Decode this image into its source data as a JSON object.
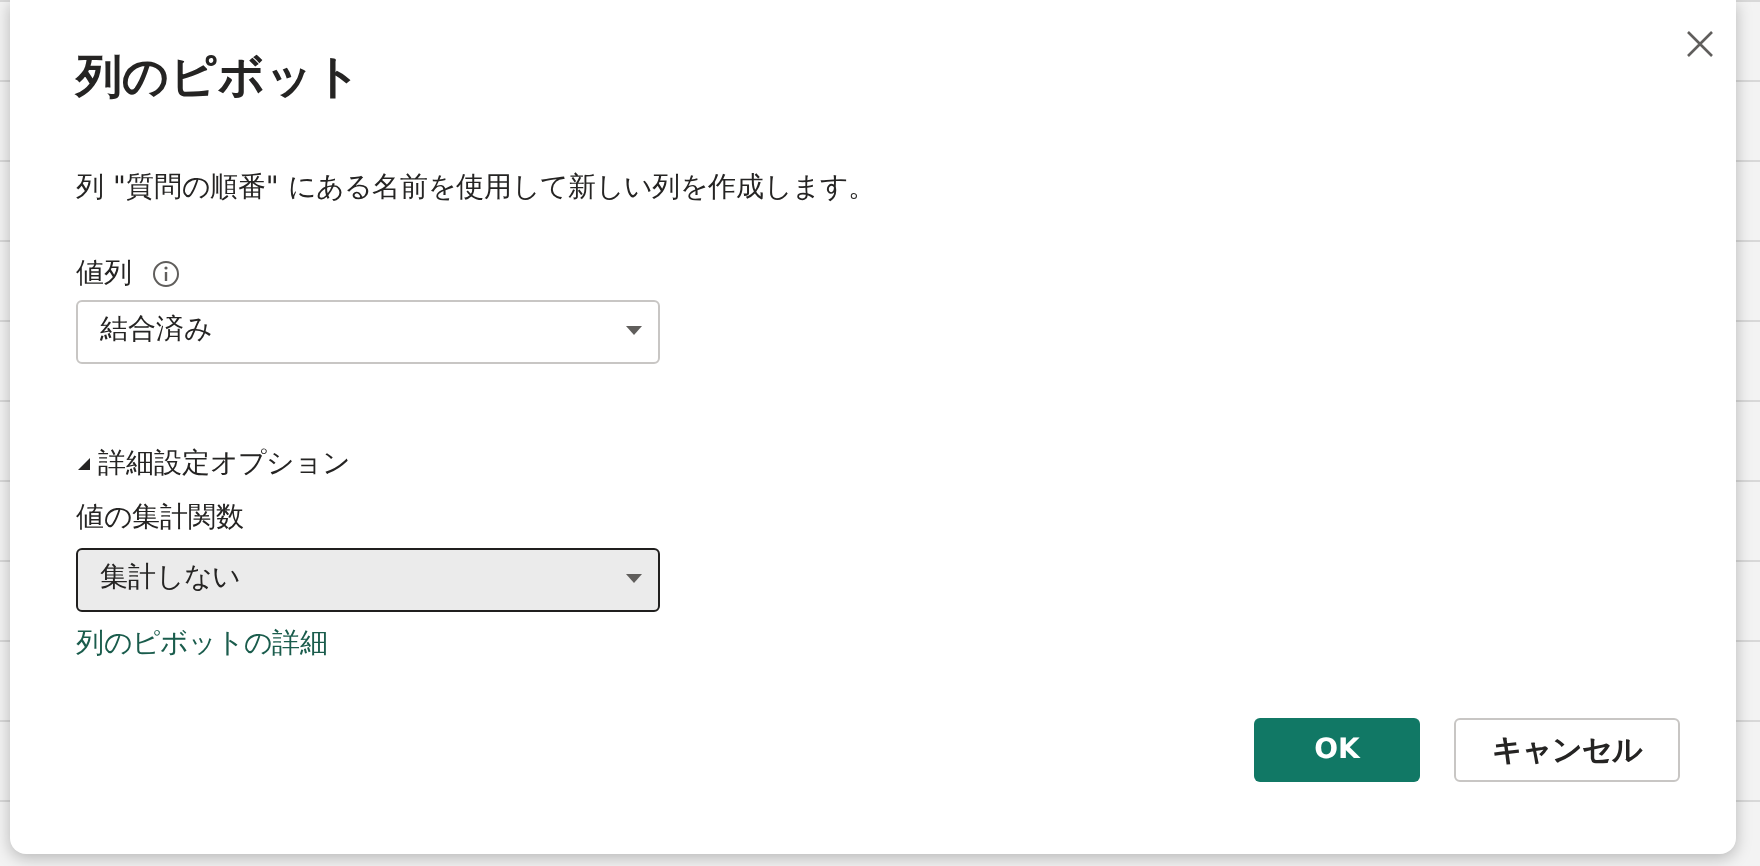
{
  "dialog": {
    "title": "列のピボット",
    "description": "列 \"質問の順番\" にある名前を使用して新しい列を作成します。"
  },
  "value_column": {
    "label": "値列",
    "value": "結合済み",
    "focused": false
  },
  "advanced": {
    "label": "詳細設定オプション",
    "expanded": true
  },
  "aggregate": {
    "label": "値の集計関数",
    "value": "集計しない",
    "focused": true
  },
  "link": "列のピボットの詳細",
  "buttons": [
    {
      "label": "OK",
      "kind": "primary"
    },
    {
      "label": "キャンセル",
      "kind": "secondary"
    }
  ]
}
